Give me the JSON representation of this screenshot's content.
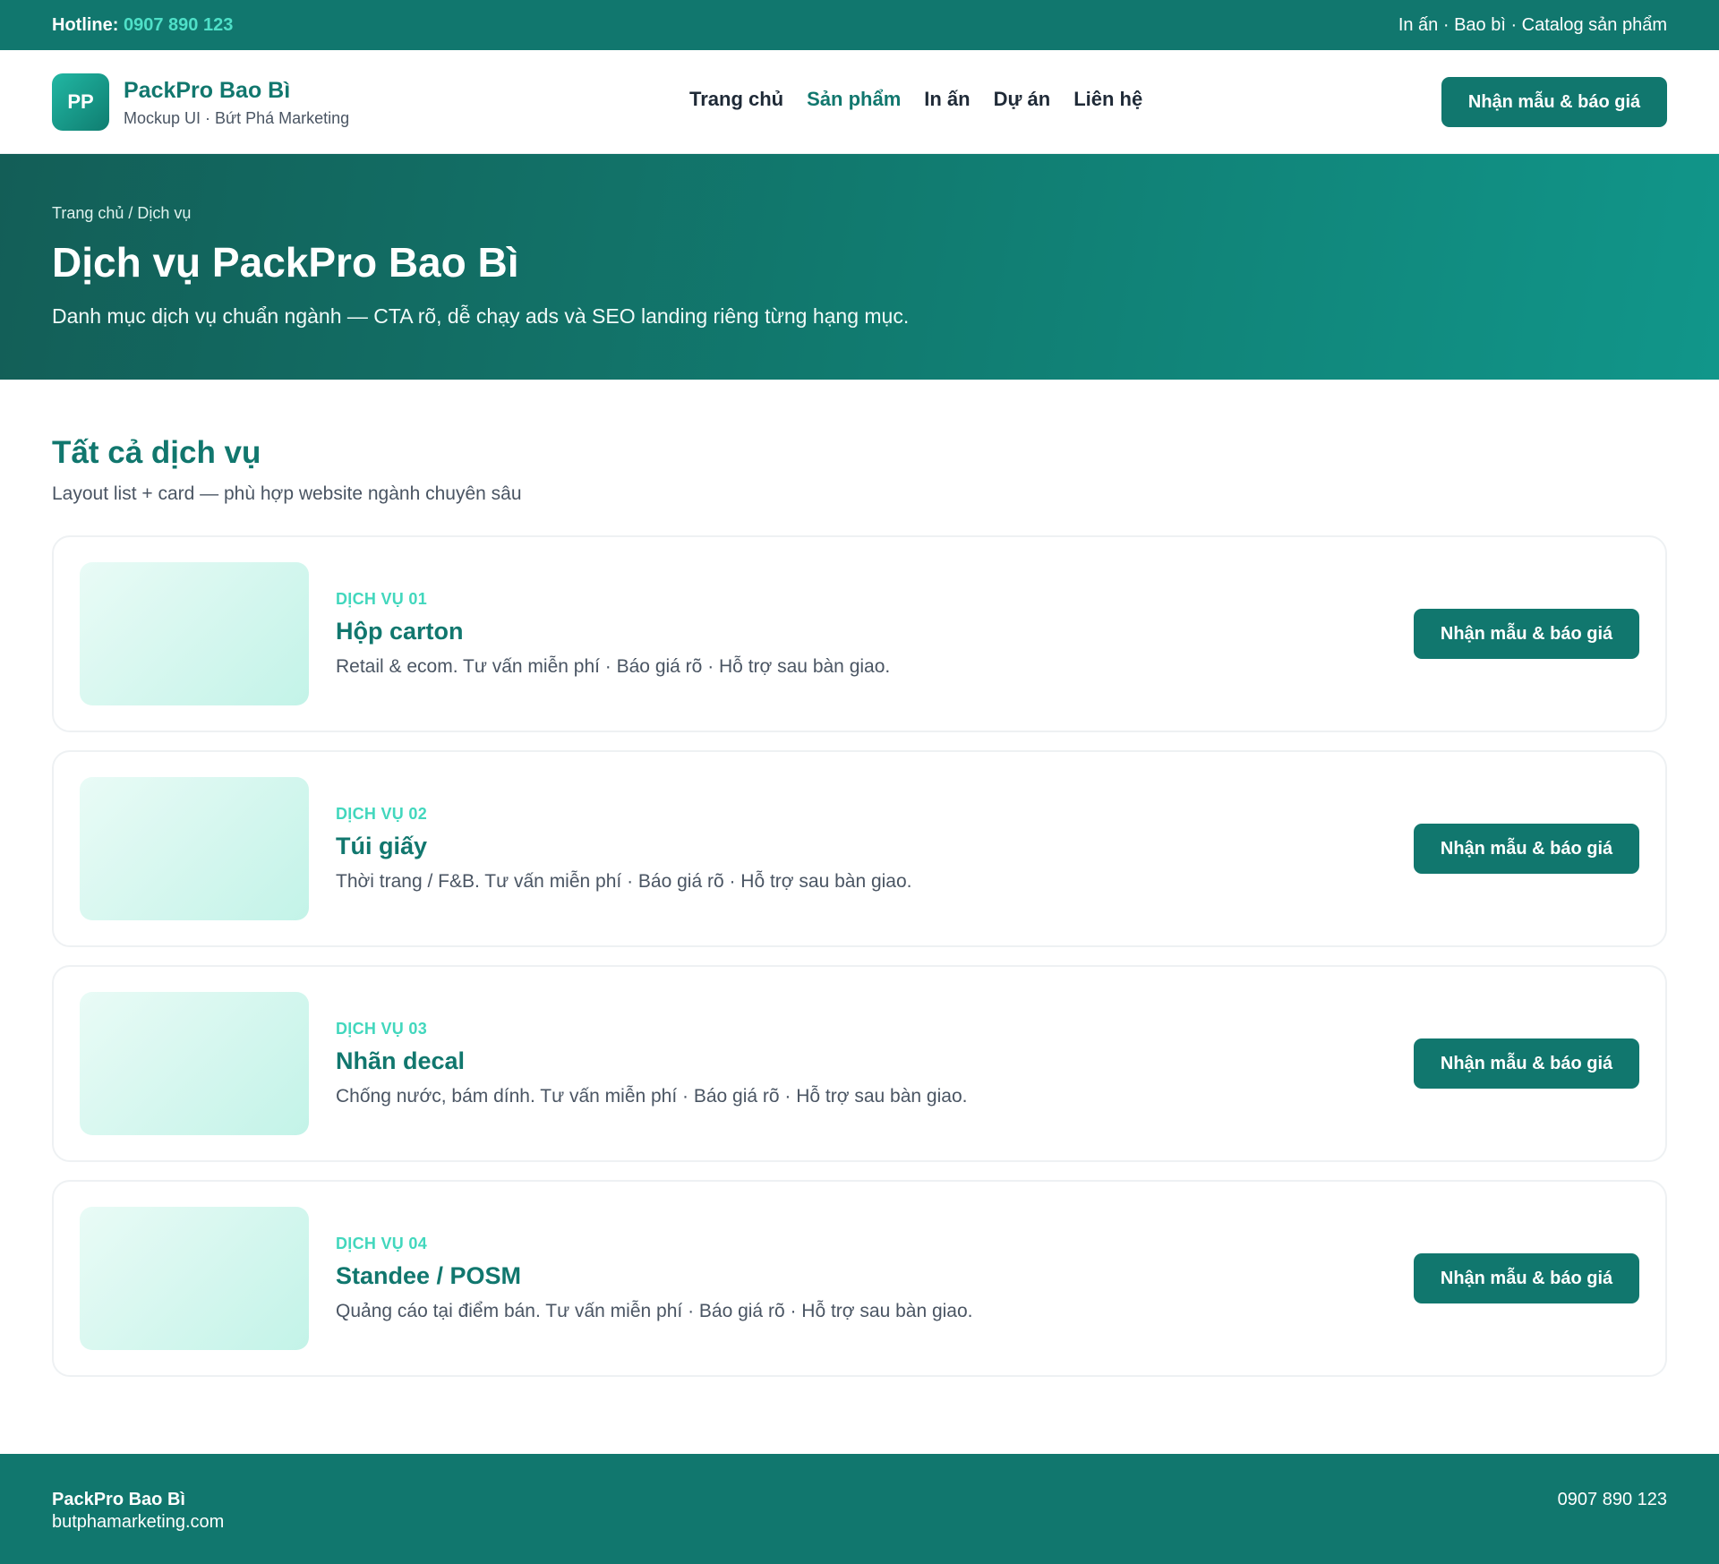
{
  "topbar": {
    "hotline_label": "Hotline:",
    "hotline_number": "0907 890 123",
    "links": "In ấn · Bao bì · Catalog sản phẩm"
  },
  "header": {
    "logo_text": "PP",
    "brand_name": "PackPro Bao Bì",
    "tagline": "Mockup UI · Bứt Phá Marketing",
    "nav": [
      {
        "label": "Trang chủ"
      },
      {
        "label": "Sản phẩm"
      },
      {
        "label": "In ấn"
      },
      {
        "label": "Dự án"
      },
      {
        "label": "Liên hệ"
      }
    ],
    "cta": "Nhận mẫu & báo giá"
  },
  "hero": {
    "breadcrumb": "Trang chủ / Dịch vụ",
    "title": "Dịch vụ PackPro Bao Bì",
    "subtitle": "Danh mục dịch vụ chuẩn ngành — CTA rõ, dễ chạy ads và SEO landing riêng từng hạng mục."
  },
  "section": {
    "title": "Tất cả dịch vụ",
    "desc": "Layout list + card — phù hợp website ngành chuyên sâu"
  },
  "services": [
    {
      "kicker": "DỊCH VỤ 01",
      "title": "Hộp carton",
      "text": "Retail & ecom. Tư vấn miễn phí · Báo giá rõ · Hỗ trợ sau bàn giao.",
      "cta": "Nhận mẫu & báo giá"
    },
    {
      "kicker": "DỊCH VỤ 02",
      "title": "Túi giấy",
      "text": "Thời trang / F&B. Tư vấn miễn phí · Báo giá rõ · Hỗ trợ sau bàn giao.",
      "cta": "Nhận mẫu & báo giá"
    },
    {
      "kicker": "DỊCH VỤ 03",
      "title": "Nhãn decal",
      "text": "Chống nước, bám dính. Tư vấn miễn phí · Báo giá rõ · Hỗ trợ sau bàn giao.",
      "cta": "Nhận mẫu & báo giá"
    },
    {
      "kicker": "DỊCH VỤ 04",
      "title": "Standee / POSM",
      "text": "Quảng cáo tại điểm bán. Tư vấn miễn phí · Báo giá rõ · Hỗ trợ sau bàn giao.",
      "cta": "Nhận mẫu & báo giá"
    }
  ],
  "footer": {
    "name": "PackPro Bao Bì",
    "site": "butphamarketing.com",
    "phone": "0907 890 123"
  },
  "colors": {
    "primary": "#11776e",
    "accent": "#42d7bd",
    "hotline": "#4fe0c8"
  }
}
